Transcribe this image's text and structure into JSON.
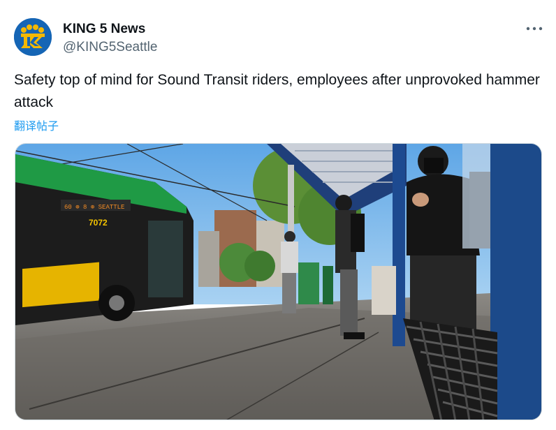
{
  "author": {
    "display_name": "KING 5 News",
    "handle": "@KING5Seattle",
    "avatar_icon": "king5-logo-icon",
    "avatar_color": "#1565b5",
    "logo_color": "#f5b800"
  },
  "more_icon": "more-horizontal-icon",
  "tweet": {
    "text": "Safety top of mind for Sound Transit riders, employees after unprovoked hammer attack",
    "translate_label": "翻译帖子"
  },
  "media": {
    "bus_number": "7072",
    "bus_sign": "60 ⊕ 8 ⊕ SEATTLE"
  },
  "colors": {
    "link": "#1d9bf0",
    "secondary_text": "#536471",
    "bus_green": "#1f9a45",
    "bus_yellow": "#e6b400"
  }
}
